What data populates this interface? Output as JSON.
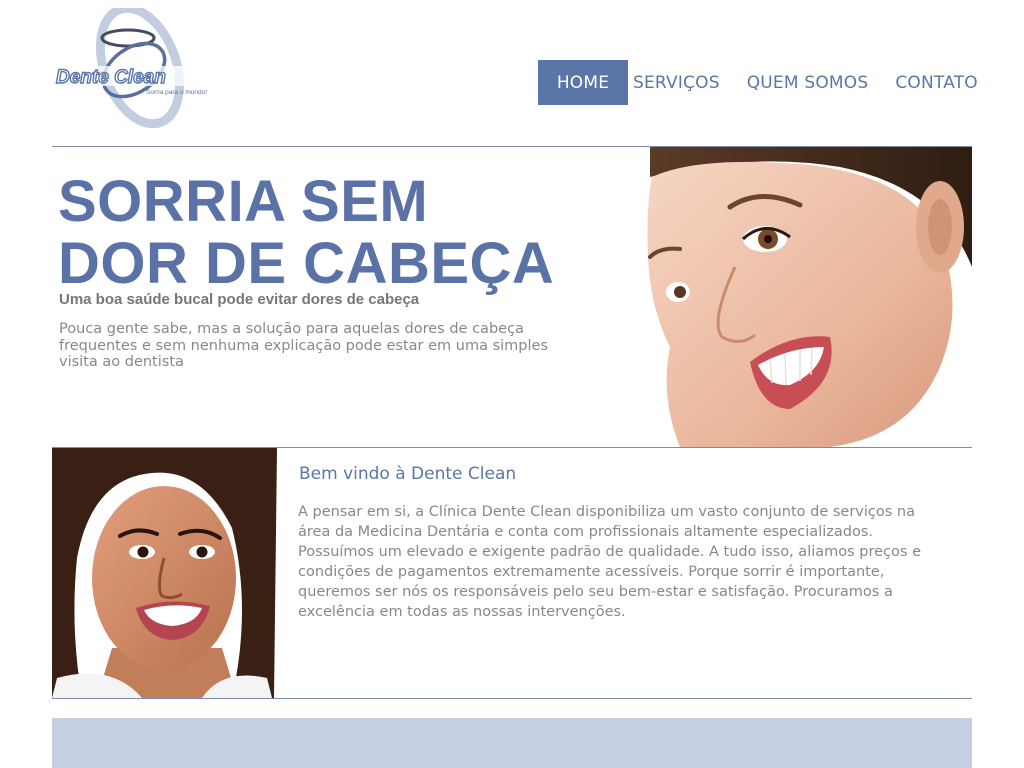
{
  "brand": {
    "logo_text": "Dente Clean",
    "logo_tagline": "Sorria para o mundo!",
    "colors": {
      "primary": "#5a76a8",
      "band": "#c6d0e2",
      "text": "#888888"
    }
  },
  "nav": {
    "items": [
      {
        "label": "HOME",
        "active": true
      },
      {
        "label": "SERVIÇOS",
        "active": false
      },
      {
        "label": "QUEM SOMOS",
        "active": false
      },
      {
        "label": "CONTATO",
        "active": false
      }
    ]
  },
  "hero": {
    "title_line1": "SORRIA SEM",
    "title_line2": "DOR DE CABEÇA",
    "subtitle": "Uma boa saúde bucal pode evitar dores de cabeça",
    "text": "Pouca gente sabe, mas a solução para aquelas dores de cabeça frequentes e sem nenhuma explicação pode estar em uma simples visita ao dentista"
  },
  "welcome": {
    "title": "Bem vindo à Dente Clean",
    "text": "A pensar em si, a Clínica Dente Clean disponibiliza um vasto conjunto de serviços na área da Medicina Dentária e conta com profissionais altamente especializados. Possuímos um elevado e exigente padrão de qualidade. A tudo isso, aliamos preços e condições de pagamentos extremamente acessíveis. Porque sorrir é importante, queremos ser nós os responsáveis pelo seu bem-estar e satisfação. Procuramos a excelência em todas as nossas intervenções."
  }
}
